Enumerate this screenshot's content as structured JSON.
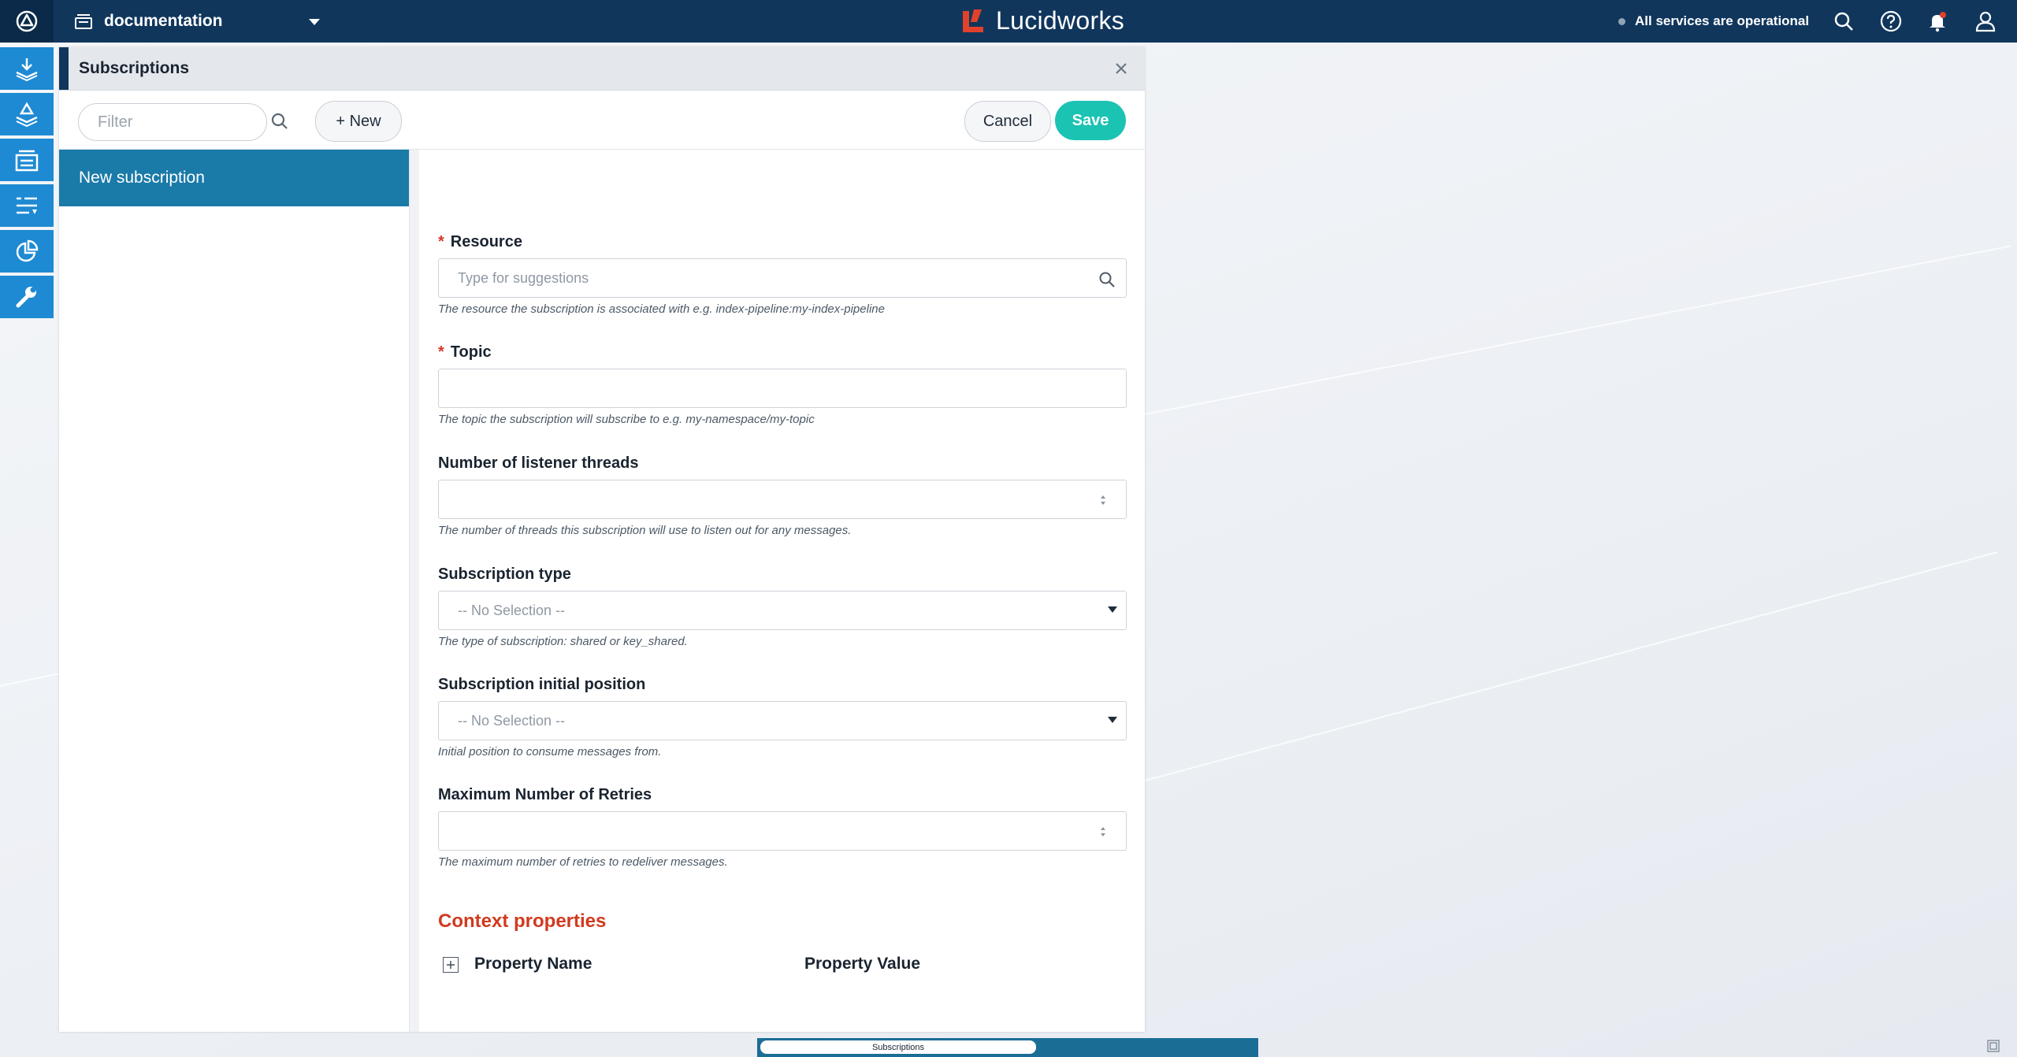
{
  "topbar": {
    "app_name": "documentation",
    "brand": "Lucidworks",
    "status_text": "All services are operational",
    "colors": {
      "bar": "#10365c",
      "brand_mark": "#e0422b",
      "notification": "#e0422b"
    }
  },
  "leftnav": {
    "items": [
      "collections-icon",
      "index-pipelines-icon",
      "datasources-icon",
      "query-pipelines-icon",
      "analytics-icon",
      "system-icon"
    ]
  },
  "panel": {
    "title": "Subscriptions",
    "filter_placeholder": "Filter",
    "new_label": "+ New",
    "cancel_label": "Cancel",
    "save_label": "Save",
    "list": [
      {
        "label": "New subscription"
      }
    ]
  },
  "form": {
    "resource": {
      "label": "Resource",
      "placeholder": "Type for suggestions",
      "help": "The resource the subscription is associated with e.g. index-pipeline:my-index-pipeline"
    },
    "topic": {
      "label": "Topic",
      "value": "",
      "help": "The topic the subscription will subscribe to e.g. my-namespace/my-topic"
    },
    "threads": {
      "label": "Number of listener threads",
      "value": "",
      "help": "The number of threads this subscription will use to listen out for any messages."
    },
    "sub_type": {
      "label": "Subscription type",
      "selected": "-- No Selection --",
      "help": "The type of subscription: shared or key_shared."
    },
    "initial_position": {
      "label": "Subscription initial position",
      "selected": "-- No Selection --",
      "help": "Initial position to consume messages from."
    },
    "max_retries": {
      "label": "Maximum Number of Retries",
      "value": "",
      "help": "The maximum number of retries to redeliver messages."
    },
    "context": {
      "title": "Context properties",
      "col_name": "Property Name",
      "col_value": "Property Value"
    }
  },
  "dock": {
    "tab_label": "Subscriptions"
  },
  "accent_colors": {
    "save": "#1bc3b3",
    "selected_item": "#1a7aa8",
    "required": "#d5382a",
    "section_title": "#d13a1f"
  }
}
